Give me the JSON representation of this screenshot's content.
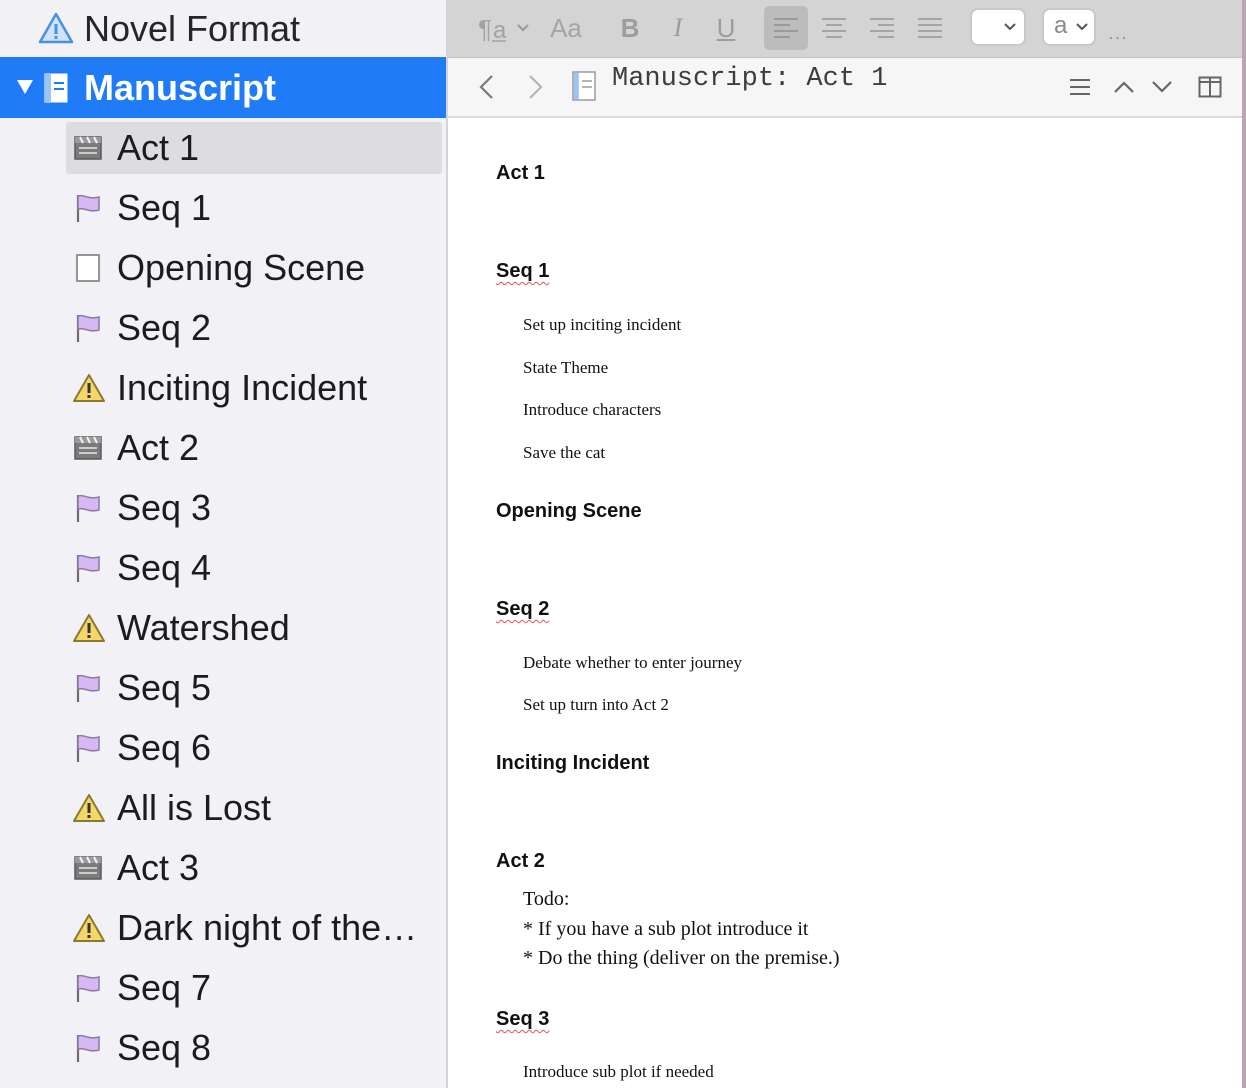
{
  "sidebar": {
    "root_label": "Novel Format",
    "manuscript_label": "Manuscript",
    "items": [
      {
        "label": "Act 1",
        "icon": "clapperboard-icon",
        "selected": true
      },
      {
        "label": "Seq 1",
        "icon": "flag-icon"
      },
      {
        "label": "Opening Scene",
        "icon": "blank-page-icon"
      },
      {
        "label": "Seq 2",
        "icon": "flag-icon"
      },
      {
        "label": "Inciting Incident",
        "icon": "warning-icon"
      },
      {
        "label": "Act 2",
        "icon": "clapperboard-icon"
      },
      {
        "label": "Seq 3",
        "icon": "flag-icon"
      },
      {
        "label": "Seq 4",
        "icon": "flag-icon"
      },
      {
        "label": "Watershed",
        "icon": "warning-icon"
      },
      {
        "label": "Seq 5",
        "icon": "flag-icon"
      },
      {
        "label": "Seq 6",
        "icon": "flag-icon"
      },
      {
        "label": "All is Lost",
        "icon": "warning-icon"
      },
      {
        "label": "Act 3",
        "icon": "clapperboard-icon"
      },
      {
        "label": "Dark night of the…",
        "icon": "warning-icon"
      },
      {
        "label": "Seq 7",
        "icon": "flag-icon"
      },
      {
        "label": "Seq 8",
        "icon": "flag-icon"
      }
    ]
  },
  "toolbar": {
    "font_size_glyph": "Aa",
    "bold_glyph": "B",
    "italic_glyph": "I",
    "underline_glyph": "U",
    "text_color_glyph": "a",
    "more_glyph": "..."
  },
  "nav": {
    "title": "Manuscript: Act 1"
  },
  "document": {
    "headings": [
      "Act 1",
      "Seq 1",
      "Opening Scene",
      "Seq 2",
      "Inciting Incident",
      "Act 2",
      "Seq 3"
    ],
    "seq1_lines": [
      "Set up inciting incident",
      "State Theme",
      "Introduce characters",
      "Save the cat"
    ],
    "seq2_lines": [
      "Debate whether to enter journey",
      "Set up turn into Act 2"
    ],
    "act2_lines": [
      "Todo:",
      "* If you have a sub plot introduce it",
      "* Do the thing (deliver on the premise.)"
    ],
    "seq3_lines": [
      "Introduce sub plot if needed"
    ]
  },
  "colors": {
    "selection_blue": "#1f7cf6",
    "flag_purple": "#d6b8f2",
    "warning_yellow": "#f5d66a",
    "spell_red": "#e15353"
  }
}
